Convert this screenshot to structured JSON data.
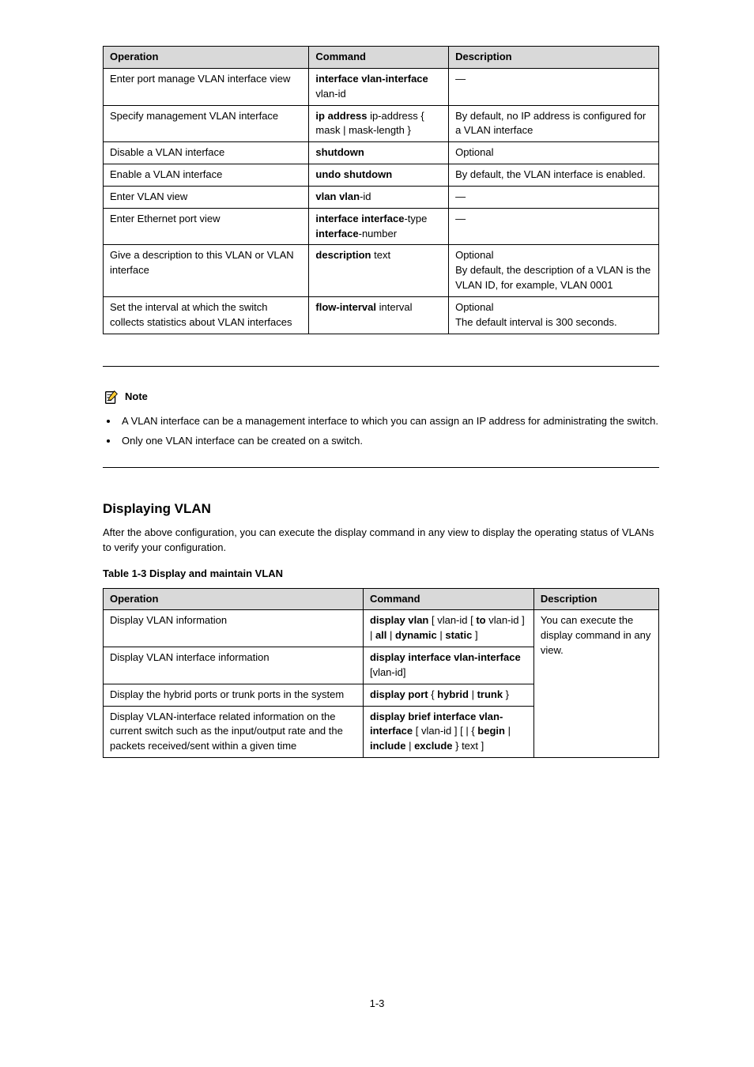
{
  "table1": {
    "head": [
      "Operation",
      "Command",
      "Description"
    ],
    "rows": [
      [
        "Enter port manage VLAN interface view",
        {
          "text": "interface vlan-interface vlan-id",
          "boldParts": [
            "interface vlan-interface"
          ]
        },
        "—"
      ],
      [
        "Specify management VLAN interface",
        {
          "text": "ip address ip-address { mask | mask-length }",
          "boldParts": [
            "ip address"
          ]
        },
        "By default, no IP address is configured for a VLAN interface"
      ],
      [
        "Disable a VLAN interface",
        {
          "text": "shutdown",
          "bold": true
        },
        "Optional"
      ],
      [
        "Enable a VLAN interface",
        {
          "text": "undo shutdown",
          "bold": true
        },
        "By default, the VLAN interface is enabled."
      ],
      [
        "Enter VLAN view",
        {
          "text": "vlan vlan-id",
          "boldParts": [
            "vlan"
          ]
        },
        "—"
      ],
      [
        "Enter Ethernet port view",
        {
          "text": "interface interface-type interface-number",
          "boldParts": [
            "interface"
          ]
        },
        "—"
      ],
      [
        "Give a description to this VLAN or VLAN interface",
        {
          "text": "description text",
          "boldParts": [
            "description"
          ]
        },
        "Optional\nBy default, the description of a VLAN is the VLAN ID, for example, VLAN 0001"
      ],
      [
        "Set the interval at which the switch collects statistics about VLAN interfaces",
        {
          "text": "flow-interval interval",
          "boldParts": [
            "flow-interval"
          ]
        },
        "Optional\nThe default interval is 300 seconds."
      ]
    ]
  },
  "note": {
    "label": "Note",
    "items": [
      "A VLAN interface can be a management interface to which you can assign an IP address for administrating the switch.",
      "Only one VLAN interface can be created on a switch."
    ]
  },
  "section": {
    "heading": "Displaying VLAN",
    "para": "After the above configuration, you can execute the display command in any view to display the operating status of VLANs to verify your configuration.",
    "caption": "Table 1-3 Display and maintain VLAN"
  },
  "table2": {
    "head": [
      "Operation",
      "Command",
      "Description"
    ],
    "rows": [
      [
        "Display VLAN information",
        {
          "text": "display vlan [ vlan-id [ to vlan-id ] | all | dynamic | static ]",
          "boldParts": [
            "display vlan",
            "to",
            "all",
            "dynamic",
            "static"
          ]
        },
        ""
      ],
      [
        "Display VLAN interface information",
        {
          "text": "display interface vlan-interface [vlan-id]",
          "boldParts": [
            "display interface vlan-interface"
          ]
        },
        "You can execute the display command in any view."
      ],
      [
        "Display the hybrid ports or trunk ports in the system",
        {
          "text": "display port { hybrid | trunk }",
          "boldParts": [
            "display port",
            "hybrid",
            "trunk"
          ]
        },
        ""
      ],
      [
        "Display VLAN-interface related information on the current switch such as the input/output rate and the packets received/sent within a given time",
        {
          "text": "display brief interface vlan-interface [ vlan-id ] [ | { begin | include | exclude } text ]",
          "boldParts": [
            "display brief interface vlan-interface",
            "begin",
            "include",
            "exclude"
          ]
        },
        ""
      ]
    ]
  },
  "pageNumber": "1-3"
}
